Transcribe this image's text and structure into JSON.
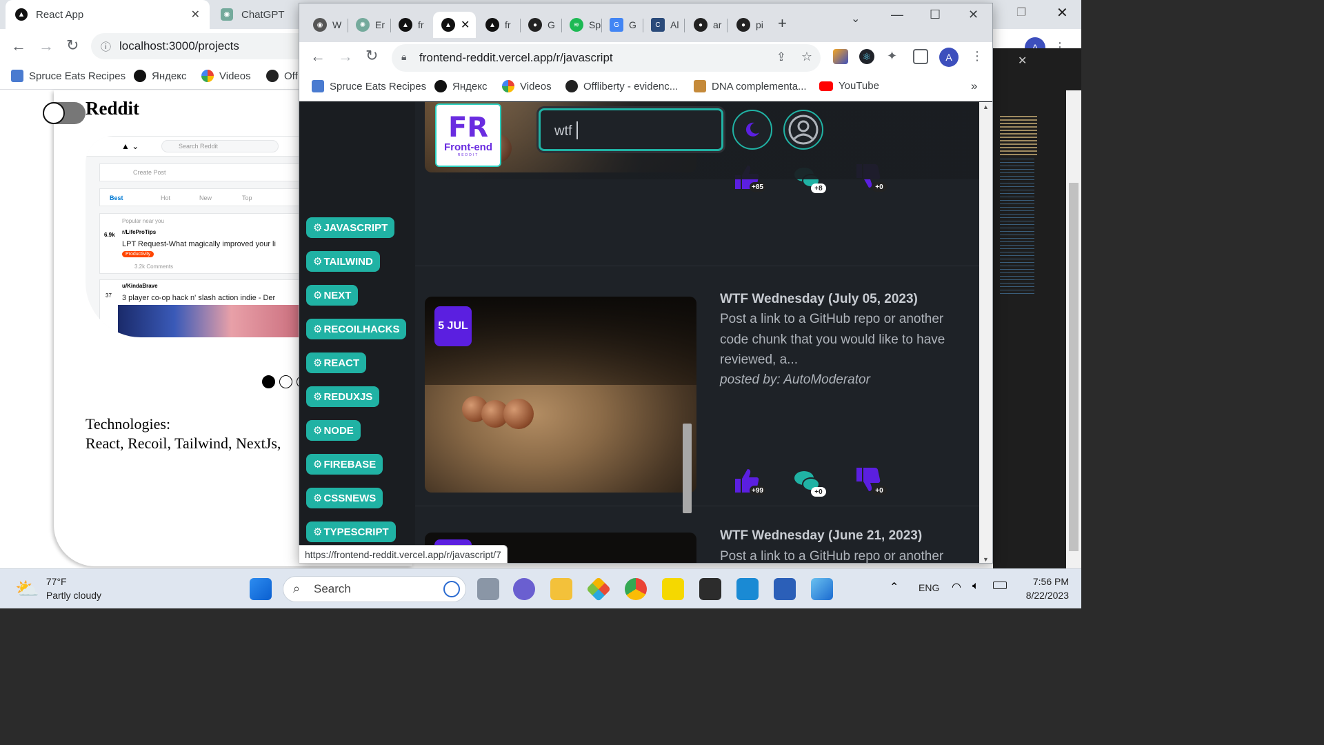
{
  "bg_browser": {
    "tabs": [
      {
        "title": "React App",
        "close": "✕"
      },
      {
        "title": "ChatGPT"
      }
    ],
    "url": "localhost:3000/projects",
    "bookmarks": [
      "Spruce Eats Recipes",
      "Яндекс",
      "Videos",
      "Off"
    ]
  },
  "bg_page": {
    "title": "Reddit",
    "thumb": {
      "search": "Search Reddit",
      "create_post": "Create Post",
      "sorts": [
        "Best",
        "Hot",
        "New",
        "Top"
      ],
      "popular": "Popular near you",
      "post1_sub": "r/LifeProTips",
      "post1_title": "LPT Request-What magically improved your li",
      "post1_tag": "Productivity",
      "post1_meta": "3.2k Comments",
      "post1_votes": "6.9k",
      "post2_sub": "u/KindaBrave",
      "post2_title": "3 player co-op hack n' slash action indie - Der",
      "post2_votes": "37"
    },
    "technologies_label": "Technologies:",
    "technologies": "React, Recoil, Tailwind, NextJs,"
  },
  "fg_browser": {
    "tabs": [
      "W",
      "Er",
      "fr",
      "",
      "fr",
      "G",
      "Sp",
      "G",
      "Al",
      "ar",
      "pi"
    ],
    "url": "frontend-reddit.vercel.app/r/javascript",
    "bookmarks": [
      "Spruce Eats Recipes",
      "Яндекс",
      "Videos",
      "Offliberty - evidenc...",
      "DNA complementa...",
      "YouTube"
    ],
    "bookmarks_more": "»",
    "profile_initial": "A",
    "status_url": "https://frontend-reddit.vercel.app/r/javascript/7"
  },
  "site": {
    "logo_mark": "FR",
    "logo_text": "Front-end",
    "logo_sub": "REDDIT",
    "search_value": "wtf",
    "subreddits": [
      "JAVASCRIPT",
      "TAILWIND",
      "NEXT",
      "RECOILHACKS",
      "REACT",
      "REDUXJS",
      "NODE",
      "FIREBASE",
      "CSSNEWS",
      "TYPESCRIPT"
    ],
    "posts": [
      {
        "likes": "+85",
        "comments": "+8",
        "dislikes": "+0"
      },
      {
        "date": "5 JUL",
        "title": "WTF Wednesday (July 05, 2023)",
        "body": "Post a link to a GitHub repo or another code chunk that you would like to have reviewed, a...",
        "author": "posted by: AutoModerator",
        "likes": "+99",
        "comments": "+0",
        "dislikes": "+0"
      },
      {
        "title": "WTF Wednesday (June 21, 2023)",
        "body": "Post a link to a GitHub repo or another"
      }
    ]
  },
  "taskbar": {
    "temp": "77°F",
    "condition": "Partly cloudy",
    "search": "Search",
    "lang": "ENG",
    "time": "7:56 PM",
    "date": "8/22/2023"
  },
  "colors": {
    "teal": "#20b2a4",
    "purple": "#5b1fe0",
    "bg_dark": "#1a1d21"
  }
}
